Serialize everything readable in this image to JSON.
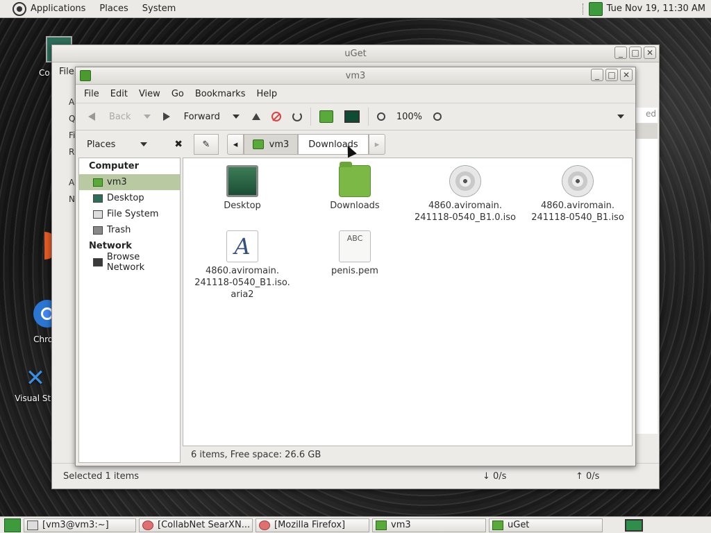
{
  "top_panel": {
    "menus": [
      "Applications",
      "Places",
      "System"
    ],
    "clock": "Tue Nov 19, 11:30 AM"
  },
  "desktop_icons": {
    "computer_label_fragment": "Co",
    "chrome_label": "Chrom",
    "vs_label": "Visual Stu"
  },
  "uget_window": {
    "title": "uGet",
    "menu_fragment": "File",
    "left_rows": [
      "A",
      "Q",
      "Fi",
      "R",
      "A",
      "N"
    ],
    "right_header_fragment": "ed",
    "status_selected": "Selected 1 items",
    "down_speed": "↓ 0/s",
    "up_speed": "↑ 0/s"
  },
  "fm_window": {
    "title": "vm3",
    "menu": [
      "File",
      "Edit",
      "View",
      "Go",
      "Bookmarks",
      "Help"
    ],
    "toolbar": {
      "back": "Back",
      "forward": "Forward",
      "zoom": "100%"
    },
    "places_label": "Places",
    "breadcrumb": {
      "home": "vm3",
      "current": "Downloads"
    },
    "sidebar": {
      "computer_heading": "Computer",
      "computer_items": [
        "vm3",
        "Desktop",
        "File System",
        "Trash"
      ],
      "network_heading": "Network",
      "network_items": [
        "Browse Network"
      ]
    },
    "files": [
      {
        "name": "Desktop",
        "type": "desktop-icon"
      },
      {
        "name": "Downloads",
        "type": "folder-icon"
      },
      {
        "name": "4860.aviromain.\n241118-0540_B1.0.iso",
        "type": "disc-icon"
      },
      {
        "name": "4860.aviromain.\n241118-0540_B1.iso",
        "type": "disc-icon"
      },
      {
        "name": "4860.aviromain.\n241118-0540_B1.iso.\naria2",
        "type": "font-icon"
      },
      {
        "name": "penis.pem",
        "type": "text-file-icon",
        "glyph": "ABC"
      }
    ],
    "status": "6 items, Free space: 26.6 GB"
  },
  "taskbar": {
    "tasks": [
      "[vm3@vm3:~]",
      "[CollabNet SearXN...",
      "[Mozilla Firefox]",
      "vm3",
      "uGet"
    ]
  }
}
